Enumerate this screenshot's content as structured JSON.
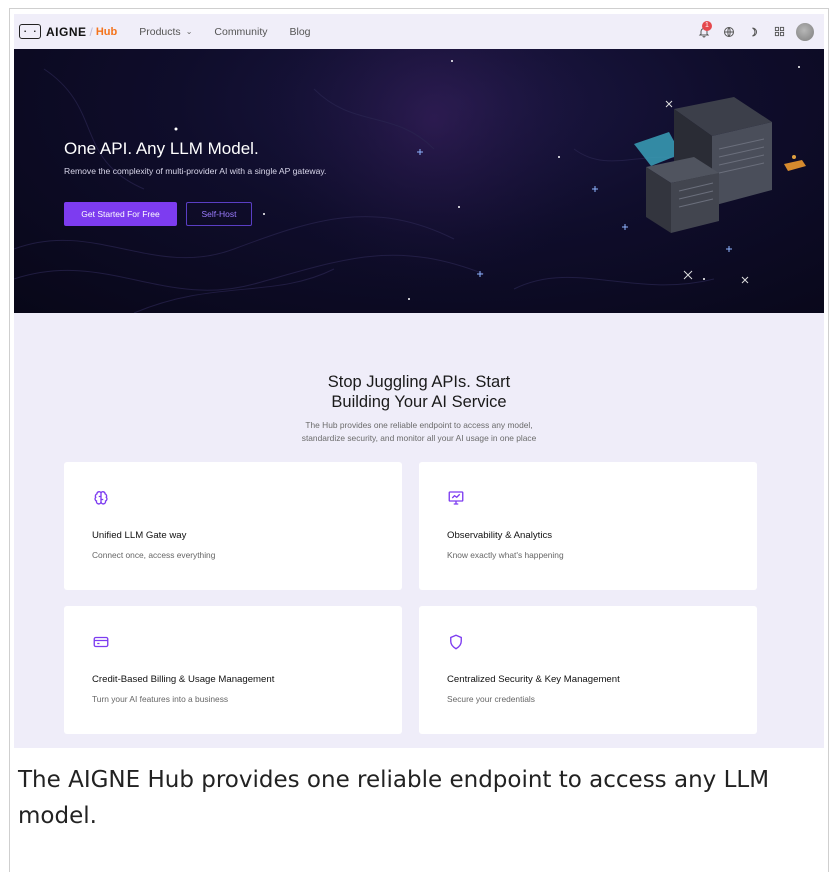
{
  "nav": {
    "logo_box": "· ·",
    "logo_text": "AIGNE",
    "logo_sep": "/",
    "logo_hub": "Hub",
    "links": [
      {
        "label": "Products",
        "has_dropdown": true
      },
      {
        "label": "Community"
      },
      {
        "label": "Blog"
      }
    ],
    "notification_count": "1",
    "icons": [
      "bell-icon",
      "globe-icon",
      "moon-icon",
      "apps-grid-icon",
      "avatar"
    ]
  },
  "hero": {
    "title": "One API. Any LLM Model.",
    "subtitle": "Remove the complexity of multi-provider AI with a single AP gateway.",
    "primary_button": "Get Started For Free",
    "secondary_button": "Self-Host"
  },
  "section": {
    "title_line1": "Stop Juggling APIs. Start",
    "title_line2": "Building Your AI Service",
    "sub_line1": "The Hub provides one reliable endpoint to access any model,",
    "sub_line2": "standardize security, and monitor all your AI usage in one place"
  },
  "features": [
    {
      "title": "Unified LLM Gate way",
      "desc": "Connect once, access everything",
      "icon": "brain-icon"
    },
    {
      "title": "Observability & Analytics",
      "desc": "Know exactly what's happening",
      "icon": "monitor-chart-icon"
    },
    {
      "title": "Credit-Based Billing & Usage Management",
      "desc": "Turn your AI features into a business",
      "icon": "credit-card-icon"
    },
    {
      "title": "Centralized Security & Key Management",
      "desc": "Secure your credentials",
      "icon": "shield-icon"
    }
  ],
  "caption": "The AIGNE Hub provides one reliable endpoint to access any LLM model.",
  "colors": {
    "accent": "#7d3cf0",
    "hub_orange": "#f4731c",
    "hero_bg": "#0f0d2b",
    "section_bg": "#efedf9"
  }
}
